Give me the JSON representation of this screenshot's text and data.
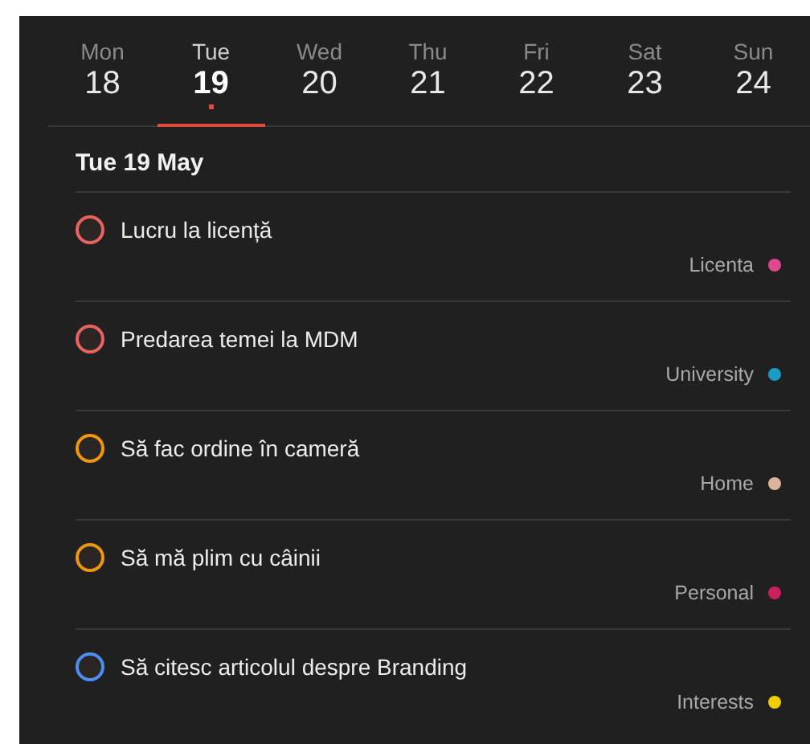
{
  "week": [
    {
      "weekday": "Mon",
      "day": "18",
      "selected": false,
      "has_items": false
    },
    {
      "weekday": "Tue",
      "day": "19",
      "selected": true,
      "has_items": true
    },
    {
      "weekday": "Wed",
      "day": "20",
      "selected": false,
      "has_items": false
    },
    {
      "weekday": "Thu",
      "day": "21",
      "selected": false,
      "has_items": false
    },
    {
      "weekday": "Fri",
      "day": "22",
      "selected": false,
      "has_items": false
    },
    {
      "weekday": "Sat",
      "day": "23",
      "selected": false,
      "has_items": false
    },
    {
      "weekday": "Sun",
      "day": "24",
      "selected": false,
      "has_items": false
    }
  ],
  "date_heading": "Tue 19 May",
  "tasks": [
    {
      "title": "Lucru la licență",
      "color": "#e8625f",
      "tag": {
        "label": "Licenta",
        "color": "#e0478f"
      }
    },
    {
      "title": "Predarea temei la MDM",
      "color": "#e8625f",
      "tag": {
        "label": "University",
        "color": "#1a9bc4"
      }
    },
    {
      "title": "Să fac ordine în cameră",
      "color": "#f0960e",
      "tag": {
        "label": "Home",
        "color": "#d9b49a"
      }
    },
    {
      "title": "Să mă plim cu câinii",
      "color": "#f0960e",
      "tag": {
        "label": "Personal",
        "color": "#c9215f"
      }
    },
    {
      "title": "Să citesc articolul despre Branding",
      "color": "#4e8ef0",
      "tag": {
        "label": "Interests",
        "color": "#f2cd00"
      }
    }
  ]
}
